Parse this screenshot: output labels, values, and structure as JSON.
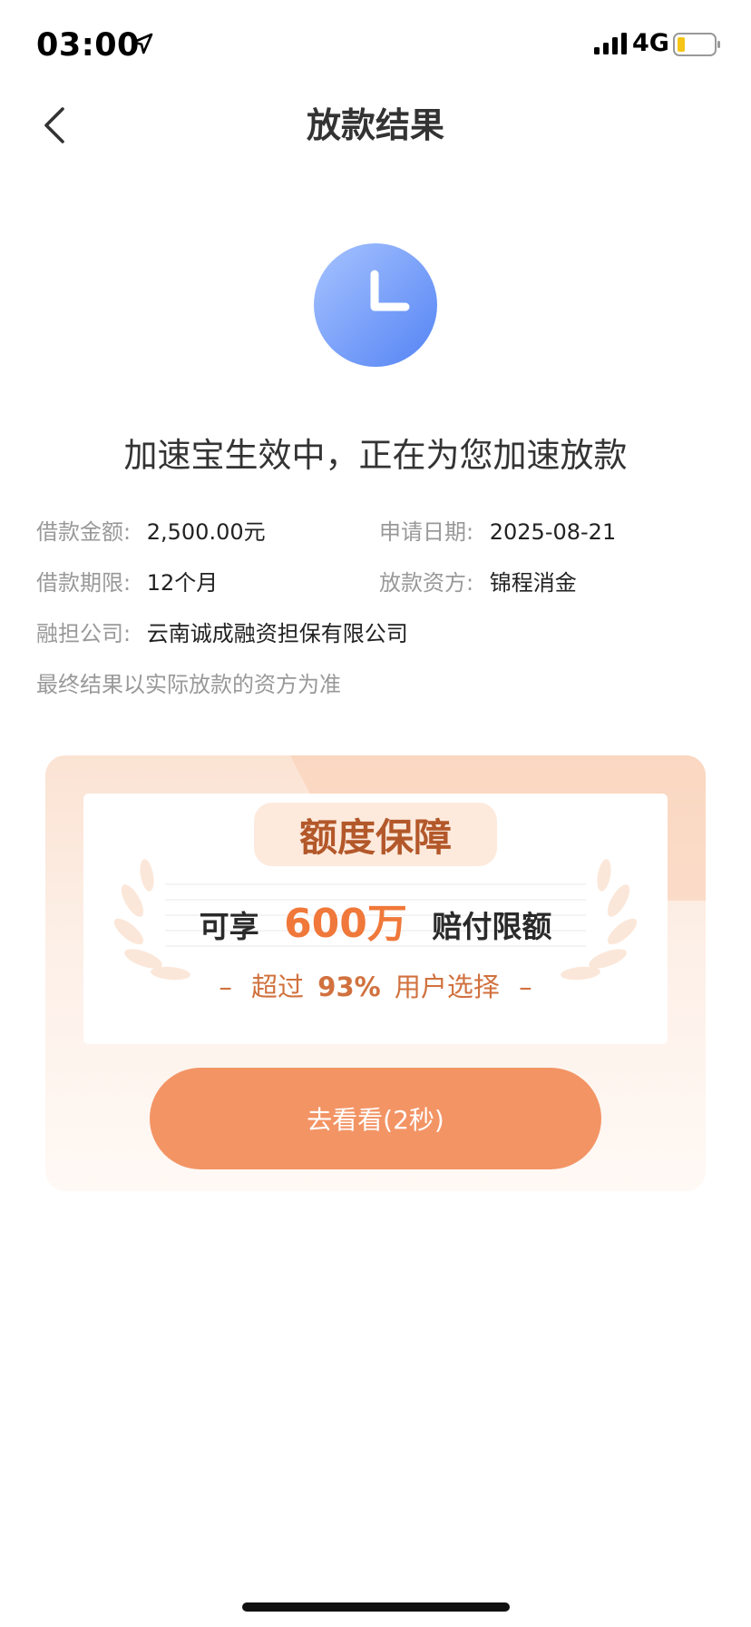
{
  "status_bar": {
    "time": "03:00",
    "network": "4G"
  },
  "nav": {
    "title": "放款结果"
  },
  "status": {
    "message": "加速宝生效中，正在为您加速放款"
  },
  "loan_info": {
    "amount_label": "借款金额:",
    "amount_value": "2,500.00元",
    "date_label": "申请日期:",
    "date_value": "2025-08-21",
    "term_label": "借款期限:",
    "term_value": "12个月",
    "funder_label": "放款资方:",
    "funder_value": "锦程消金",
    "guarantor_label": "融担公司:",
    "guarantor_value": "云南诚成融资担保有限公司",
    "disclaimer": "最终结果以实际放款的资方为准"
  },
  "promo": {
    "badge": "额度保障",
    "prefix": "可享",
    "amount": "600万",
    "suffix": "赔付限额",
    "dash_left": "–",
    "sub_prefix": "超过",
    "sub_percent": "93%",
    "sub_suffix": "用户选择",
    "dash_right": "–",
    "button_label": "去看看(2秒)"
  },
  "colors": {
    "accent_orange": "#f39465",
    "amount_orange": "#f0783a",
    "clock_blue": "#5b8df5"
  }
}
